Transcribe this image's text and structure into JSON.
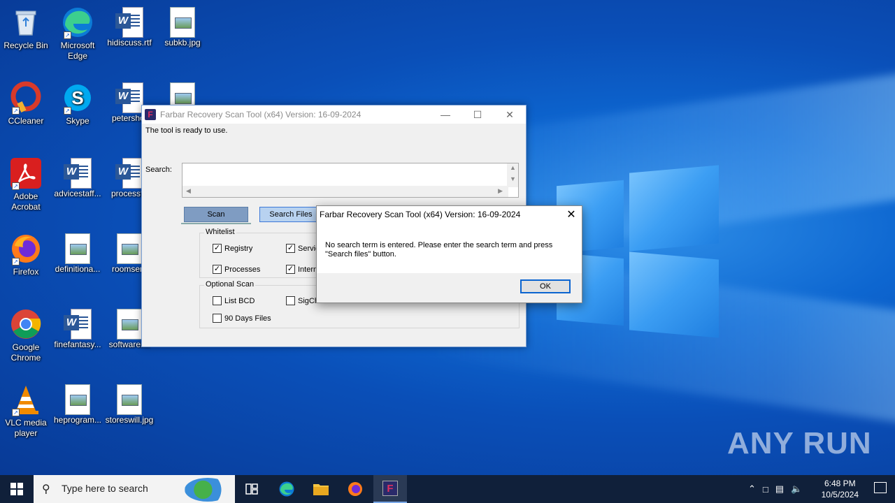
{
  "desktop": {
    "icons": [
      {
        "label": "Recycle Bin"
      },
      {
        "label": "Microsoft Edge"
      },
      {
        "label": "hidiscuss.rtf"
      },
      {
        "label": "subkb.jpg"
      },
      {
        "label": "CCleaner"
      },
      {
        "label": "Skype"
      },
      {
        "label": "petershot"
      },
      {
        "label": "Adobe Acrobat"
      },
      {
        "label": "advicestaff..."
      },
      {
        "label": "processfa"
      },
      {
        "label": "Firefox"
      },
      {
        "label": "definitiona..."
      },
      {
        "label": "roomserv"
      },
      {
        "label": "Google Chrome"
      },
      {
        "label": "finefantasy..."
      },
      {
        "label": "softwarer..."
      },
      {
        "label": "VLC media player"
      },
      {
        "label": "heprogram..."
      },
      {
        "label": "storeswill.jpg"
      }
    ]
  },
  "main_window": {
    "title": "Farbar Recovery Scan Tool (x64) Version: 16-09-2024",
    "status": "The tool is ready to use.",
    "search_label": "Search:",
    "scan_button": "Scan",
    "search_files_button": "Search Files",
    "whitelist_label": "Whitelist",
    "whitelist": [
      {
        "label": "Registry",
        "checked": true
      },
      {
        "label": "Servic",
        "checked": true
      },
      {
        "label": "Processes",
        "checked": true
      },
      {
        "label": "Interne",
        "checked": true
      }
    ],
    "optional_scan_label": "Optional Scan",
    "optional": [
      {
        "label": "List BCD",
        "checked": false
      },
      {
        "label": "SigCh",
        "checked": false
      },
      {
        "label": "90 Days Files",
        "checked": false
      }
    ]
  },
  "dialog": {
    "title": "Farbar Recovery Scan Tool (x64) Version: 16-09-2024",
    "message_line1": "No search term is entered. Please enter the search term and press",
    "message_line2": "\"Search files\" button.",
    "ok_button": "OK"
  },
  "watermark": "ANY RUN",
  "taskbar": {
    "search_placeholder": "Type here to search",
    "time": "6:48 PM",
    "date": "10/5/2024"
  }
}
